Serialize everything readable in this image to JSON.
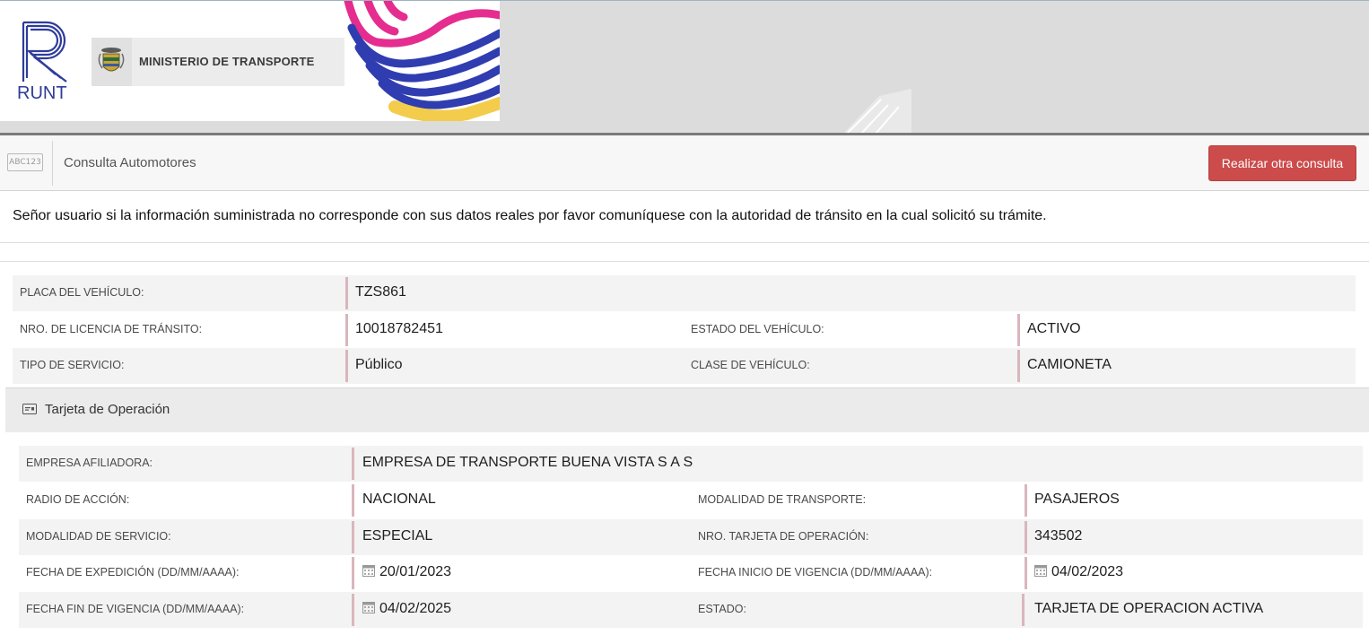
{
  "header": {
    "logo_text": "RUNT",
    "ministry": "MINISTERIO DE TRANSPORTE"
  },
  "toolbar": {
    "icon_text": "ABC123",
    "title": "Consulta Automotores",
    "button_label": "Realizar otra consulta"
  },
  "notice": "Señor usuario si la información suministrada no corresponde con sus datos reales por favor comuníquese con la autoridad de tránsito en la cual solicitó su trámite.",
  "vehicle": {
    "placa_label": "PLACA DEL VEHÍCULO:",
    "placa_value": "TZS861",
    "licencia_label": "NRO. DE LICENCIA DE TRÁNSITO:",
    "licencia_value": "10018782451",
    "estado_label": "ESTADO DEL VEHÍCULO:",
    "estado_value": "ACTIVO",
    "servicio_label": "TIPO DE SERVICIO:",
    "servicio_value": "Público",
    "clase_label": "CLASE DE VEHÍCULO:",
    "clase_value": "CAMIONETA"
  },
  "section": {
    "title": "Tarjeta de Operación"
  },
  "tarjeta": {
    "empresa_label": "EMPRESA AFILIADORA:",
    "empresa_value": "EMPRESA DE TRANSPORTE BUENA VISTA S A S",
    "radio_label": "RADIO DE ACCIÓN:",
    "radio_value": "NACIONAL",
    "mod_transporte_label": "MODALIDAD DE TRANSPORTE:",
    "mod_transporte_value": "PASAJEROS",
    "mod_servicio_label": "MODALIDAD DE SERVICIO:",
    "mod_servicio_value": "ESPECIAL",
    "nro_tarjeta_label": "NRO. TARJETA DE OPERACIÓN:",
    "nro_tarjeta_value": "343502",
    "fecha_exp_label": "FECHA DE EXPEDICIÓN (DD/MM/AAAA):",
    "fecha_exp_value": "20/01/2023",
    "fecha_ini_label": "FECHA INICIO DE VIGENCIA (DD/MM/AAAA):",
    "fecha_ini_value": "04/02/2023",
    "fecha_fin_label": "FECHA FIN DE VIGENCIA (DD/MM/AAAA):",
    "fecha_fin_value": "04/02/2025",
    "estado_label": "ESTADO:",
    "estado_value": "TARJETA DE OPERACION ACTIVA"
  },
  "colors": {
    "button": "#cc4b4b",
    "runt_blue": "#2f3c9a",
    "value_bar": "#d9b6bd"
  }
}
